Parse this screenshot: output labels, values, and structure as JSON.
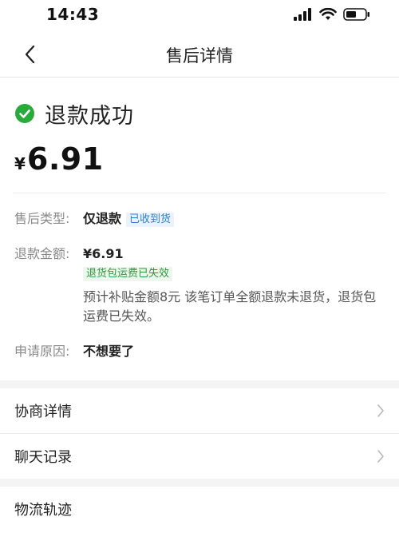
{
  "status_bar": {
    "time": "14:43"
  },
  "nav": {
    "title": "售后详情"
  },
  "summary": {
    "status": "退款成功",
    "currency": "¥",
    "amount": "6.91",
    "status_color": "#2aaa3a"
  },
  "details": {
    "type_label": "售后类型:",
    "type_value": "仅退款",
    "type_tag": "已收到货",
    "amount_label": "退款金额:",
    "amount_value": "¥6.91",
    "shipping_tag": "退货包运费已失效",
    "note": "预计补贴金额8元 该笔订单全额退款未退货，退货包运费已失效。",
    "reason_label": "申请原因:",
    "reason_value": "不想要了"
  },
  "menu": {
    "negotiation": "协商详情",
    "chat": "聊天记录",
    "logistics": "物流轨迹"
  }
}
